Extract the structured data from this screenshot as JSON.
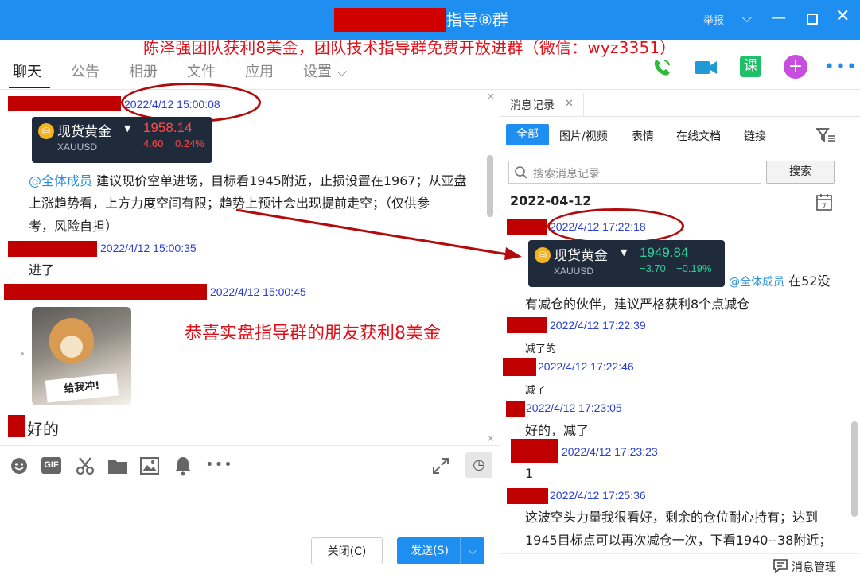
{
  "window": {
    "title": "指导⑧群",
    "report_label": "举报",
    "promo_banner": "陈泽强团队获利8美金，团队技术指导群免费开放进群（微信：wyz3351）"
  },
  "tabs": [
    {
      "label": "聊天"
    },
    {
      "label": "公告"
    },
    {
      "label": "相册"
    },
    {
      "label": "文件"
    },
    {
      "label": "应用"
    },
    {
      "label": "设置 ⌵"
    }
  ],
  "chat": {
    "messages": [
      {
        "time": "2022/4/12 15:00:08"
      },
      {
        "time": "2022/4/12 15:00:35",
        "text": "进了"
      },
      {
        "time": "2022/4/12 15:00:45"
      },
      {
        "text": "好的"
      }
    ],
    "card": {
      "name": "现货黄金",
      "code": "XAUUSD",
      "price": "1958.14",
      "change": "4.60",
      "change_pct": "0.24%"
    },
    "mention": "@全体成员",
    "advice_lines": [
      "建议现价空单进场，目标看1945附近，止损设置在1967；从亚盘",
      "上涨趋势看，上方力度空间有限；趋势上预计会出现提前走空；（仅供参",
      "考，风险自担）"
    ],
    "sticker_text": "给我冲!",
    "annotation": "恭喜实盘指导群的朋友获利8美金",
    "close_button": "关闭(C)",
    "send_button": "发送(S)"
  },
  "history": {
    "title": "消息记录",
    "filters": [
      "全部",
      "图片/视频",
      "表情",
      "在线文档",
      "链接"
    ],
    "search_placeholder": "搜索消息记录",
    "search_button": "搜索",
    "date": "2022-04-12",
    "card": {
      "name": "现货黄金",
      "code": "XAUUSD",
      "price": "1949.84",
      "change": "−3.70",
      "change_pct": "−0.19%"
    },
    "mention": "@全体成员",
    "first_text_a": "在52没",
    "first_text_b": "有减仓的伙伴，建议严格获利8个点减仓",
    "items": [
      {
        "time": "2022/4/12 17:22:18"
      },
      {
        "time": "2022/4/12 17:22:39",
        "text": "减了的"
      },
      {
        "time": "2022/4/12 17:22:46",
        "text": "减了"
      },
      {
        "time": "2022/4/12 17:23:05",
        "text": "好的，减了"
      },
      {
        "time": "2022/4/12 17:23:23",
        "text": "1"
      },
      {
        "time": "2022/4/12 17:25:36",
        "text": "这波空头力量我很看好，剩余的仓位耐心持有；达到"
      }
    ],
    "last_line": "1945目标点可以再次减仓一次，下看1940--38附近；",
    "manage_button": "消息管理"
  },
  "colors": {
    "accent": "#1e8ef0",
    "redact": "#c00000",
    "promo": "#e0101a",
    "timestamp": "#2a3fd0"
  }
}
